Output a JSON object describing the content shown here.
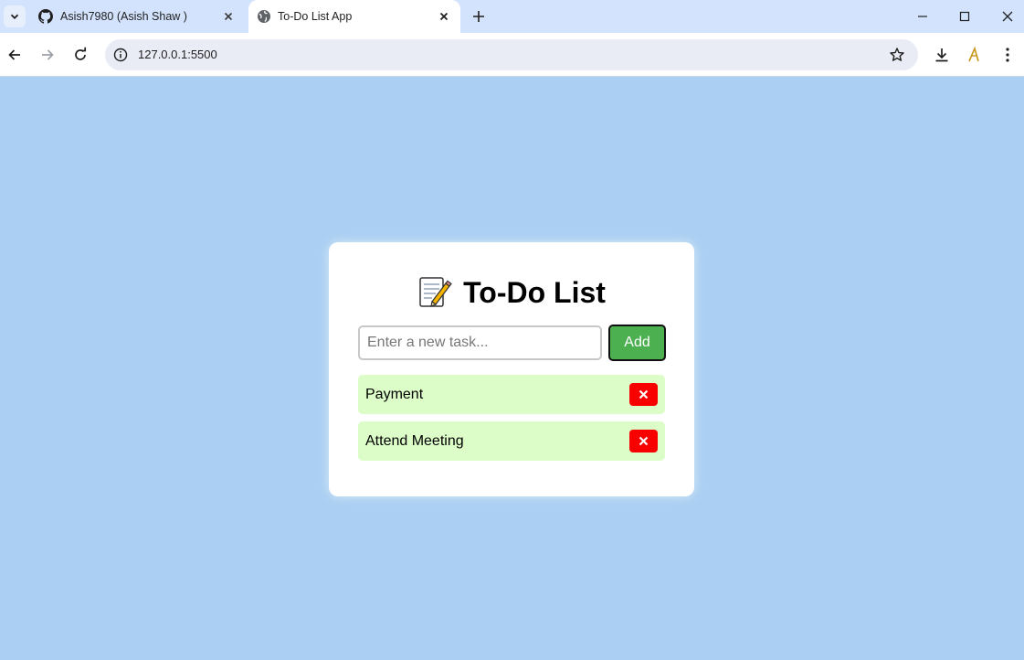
{
  "browser": {
    "tabs": [
      {
        "title": "Asish7980 (Asish Shaw )",
        "favicon": "github-icon",
        "active": false
      },
      {
        "title": "To-Do List App",
        "favicon": "globe-icon",
        "active": true
      }
    ],
    "address": "127.0.0.1:5500"
  },
  "app": {
    "title": "To-Do List",
    "title_icon": "memo-icon",
    "input_placeholder": "Enter a new task...",
    "add_label": "Add",
    "tasks": [
      {
        "text": "Payment"
      },
      {
        "text": "Attend Meeting"
      }
    ]
  },
  "colors": {
    "page_bg": "#aacff2",
    "add_button": "#4caf50",
    "task_bg": "#dcfdc8",
    "delete_button": "#f80000"
  }
}
